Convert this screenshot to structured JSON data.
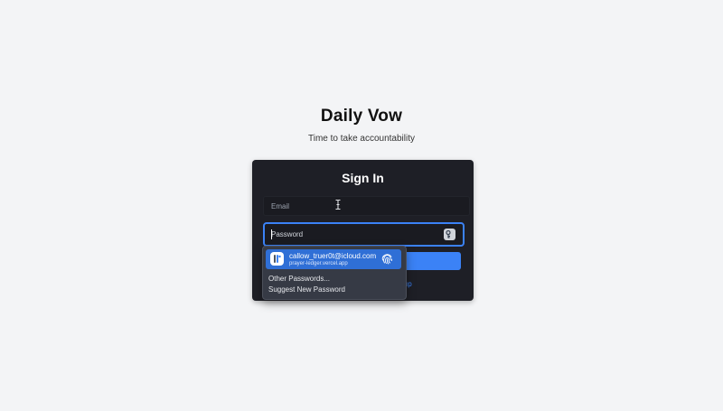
{
  "header": {
    "title": "Daily Vow",
    "subtitle": "Time to take accountability"
  },
  "signin": {
    "heading": "Sign In",
    "email_placeholder": "Email",
    "email_value": "",
    "password_placeholder": "Password",
    "password_value": "",
    "submit_label": "",
    "signup_link_partial": "ıp"
  },
  "autofill": {
    "suggestion": {
      "username": "callow_truer0t@icloud.com",
      "site": "prayer-ledger.vercel.app",
      "icon": "passwords-app-icon",
      "action_icon": "fingerprint-icon"
    },
    "options": [
      "Other Passwords...",
      "Suggest New Password"
    ]
  },
  "colors": {
    "page_background": "#f3f4f6",
    "card_background": "#1e1f26",
    "accent": "#3b82f6",
    "popup_background": "#363a45",
    "popup_highlight": "#2f6fd6"
  },
  "icons": {
    "password_field": "key-icon",
    "mouse_cursor": "ibeam-cursor-icon"
  }
}
